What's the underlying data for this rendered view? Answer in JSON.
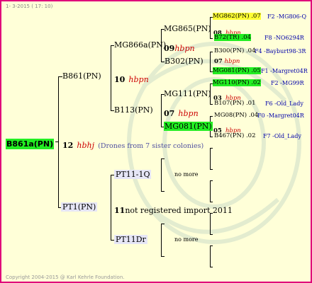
{
  "header": {
    "date": "1-  3-2015  ( 17: 10)"
  },
  "footer": {
    "copyright": "Copyright 2004-2015 @ Karl Kehrle Foundation."
  },
  "root": {
    "name": "B861a(PN)",
    "num": "12",
    "hb": "hbhj",
    "drones": "(Drones from 7 sister colonies)"
  },
  "gen1": [
    {
      "name": "B861(PN)",
      "num": "10",
      "hb": "hbpn"
    },
    {
      "name": "PT1(PN)",
      "num": "11",
      "note": "not registered import 2011"
    }
  ],
  "gen2": [
    {
      "name": "MG866a(PN)",
      "num": "09",
      "hb": "hbpn"
    },
    {
      "name": "B113(PN)",
      "num": "07",
      "hb": "hbpn"
    },
    {
      "name": "PT11-1Q"
    },
    {
      "name": "PT11Dr"
    }
  ],
  "gen3": [
    {
      "name": "MG865(PN)",
      "num": "08",
      "hb": "hbpn"
    },
    {
      "name": "B302(PN)"
    },
    {
      "name": "MG111(PN)",
      "num": "03",
      "hb": "hbpn"
    },
    {
      "name": "MG081(PN)",
      "num": "05",
      "hb": "hbpn"
    }
  ],
  "gen4": [
    {
      "name": "MG862(PN)",
      "year": ".07",
      "ref": "F2 -MG806-Q"
    },
    {
      "name": "B72(TR)",
      "year": ".04",
      "ref": "F8 -NO6294R"
    },
    {
      "name": "B300(PN)",
      "year": ".04",
      "ref": "F4 -Bayburt98-3R"
    },
    {
      "name": "MG081(PN)",
      "year": ".05",
      "ref": "F1 -Margret04R"
    },
    {
      "name": "MG110(PN)",
      "year": ".02",
      "ref": "F2 -MG99R"
    },
    {
      "name": "B107(PN)",
      "year": ".01",
      "ref": "F6 -Old_Lady"
    },
    {
      "name": "MG08(PN)",
      "year": ".04",
      "ref": "F0 -Margret04R"
    },
    {
      "name": "B467(PN)",
      "year": ".02",
      "ref": "F7 -Old_Lady"
    }
  ],
  "no_more": "no more",
  "colors": {
    "border": "#e0007a",
    "background": "#ffffd8",
    "highlight_green": "#22ee22",
    "highlight_yellow": "#ffff33",
    "ref_blue": "#0000aa",
    "hb_red": "#cc0000"
  }
}
